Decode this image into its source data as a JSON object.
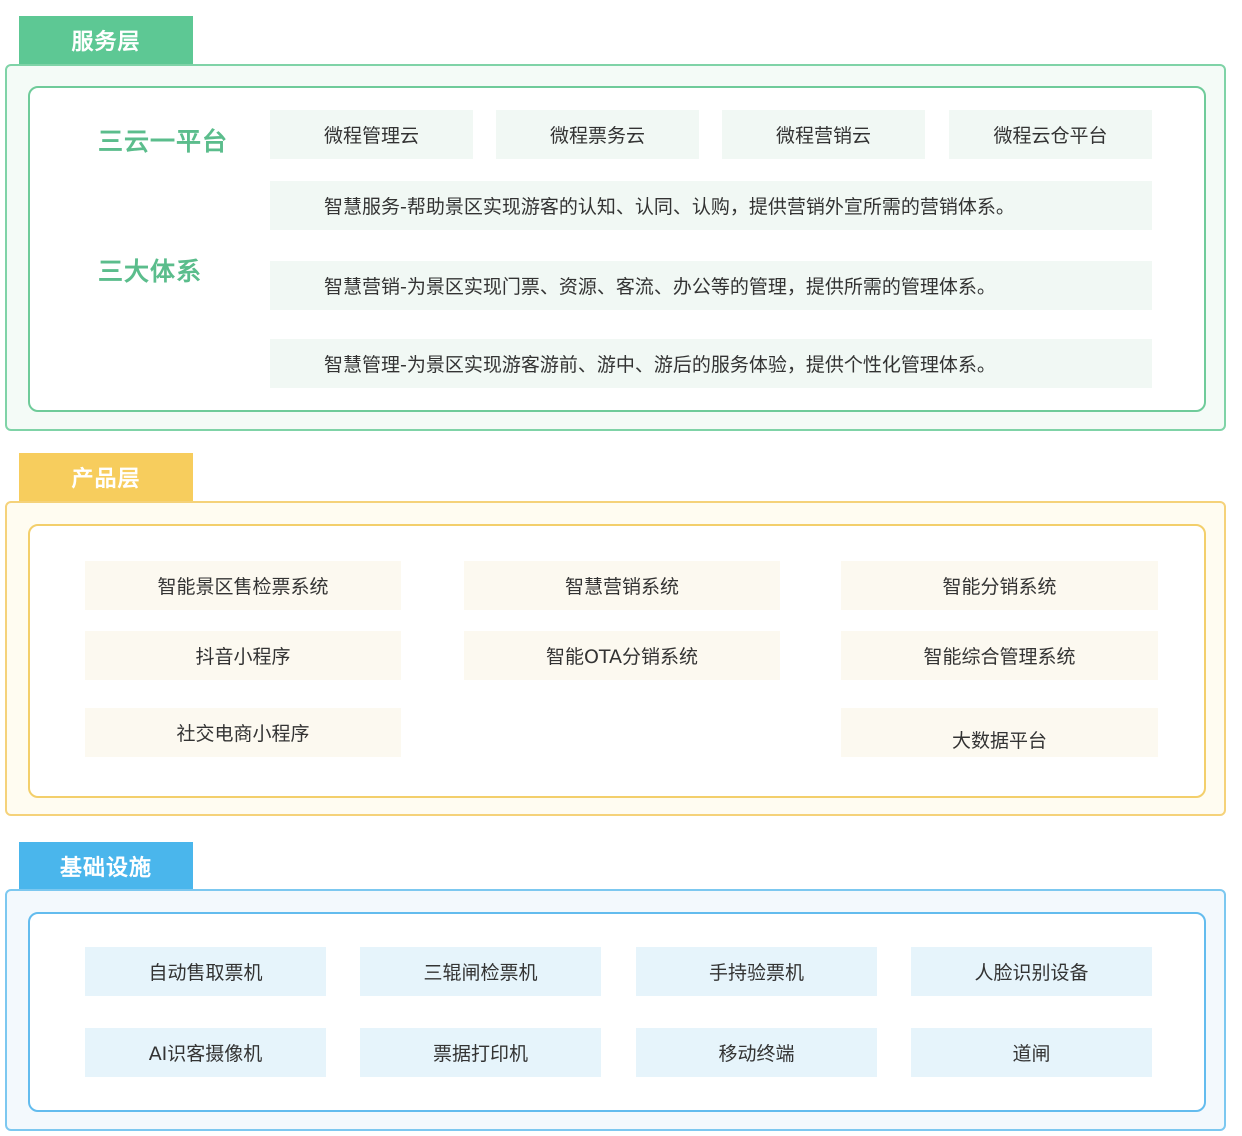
{
  "service_layer": {
    "tag": "服务层",
    "platform_title": "三云一平台",
    "clouds": [
      "微程管理云",
      "微程票务云",
      "微程营销云",
      "微程云仓平台"
    ],
    "systems_title": "三大体系",
    "systems": [
      "智慧服务-帮助景区实现游客的认知、认同、认购，提供营销外宣所需的营销体系。",
      "智慧营销-为景区实现门票、资源、客流、办公等的管理，提供所需的管理体系。",
      "智慧管理-为景区实现游客游前、游中、游后的服务体验，提供个性化管理体系。"
    ]
  },
  "product_layer": {
    "tag": "产品层",
    "col1": [
      "智能景区售检票系统",
      "抖音小程序",
      "社交电商小程序"
    ],
    "col2": [
      "智慧营销系统",
      "智能OTA分销系统"
    ],
    "col3": [
      "智能分销系统",
      "智能综合管理系统",
      "大数据平台"
    ]
  },
  "infrastructure_layer": {
    "tag": "基础设施",
    "row1": [
      "自动售取票机",
      "三辊闸检票机",
      "手持验票机",
      "人脸识别设备"
    ],
    "row2": [
      "AI识客摄像机",
      "票据打印机",
      "移动终端",
      "道闸"
    ]
  },
  "colors": {
    "service": "#5dc894",
    "product": "#f7cd5d",
    "infrastructure": "#4ab6ec"
  }
}
